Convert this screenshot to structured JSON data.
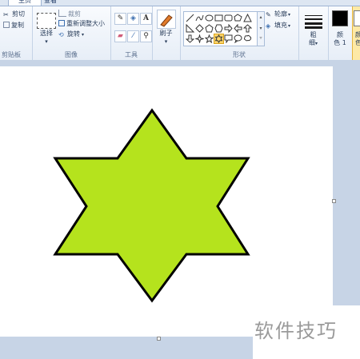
{
  "tabs": {
    "home": "主页",
    "view": "查看"
  },
  "clipboard": {
    "cut": "剪切",
    "copy": "复制",
    "label": "剪贴板"
  },
  "image": {
    "select": "选择",
    "crop": "裁剪",
    "resize": "重新调整大小",
    "rotate": "旋转",
    "label": "图像"
  },
  "tools": {
    "text_tool": "A",
    "label": "工具"
  },
  "brushes": {
    "label": "刷子"
  },
  "shapes": {
    "outline": "轮廓",
    "fill": "填充",
    "label": "形状"
  },
  "size": {
    "label_line1": "粗",
    "label_line2": "细"
  },
  "colors": {
    "color1_line1": "颜",
    "color1_line2": "色 1",
    "color2_line1": "颜",
    "color2_line2": "色",
    "color1_value": "#000000",
    "color2_value": "#ffffff",
    "star_fill": "#b5e31d",
    "star_stroke": "#000000"
  },
  "watermark": "软件技巧"
}
